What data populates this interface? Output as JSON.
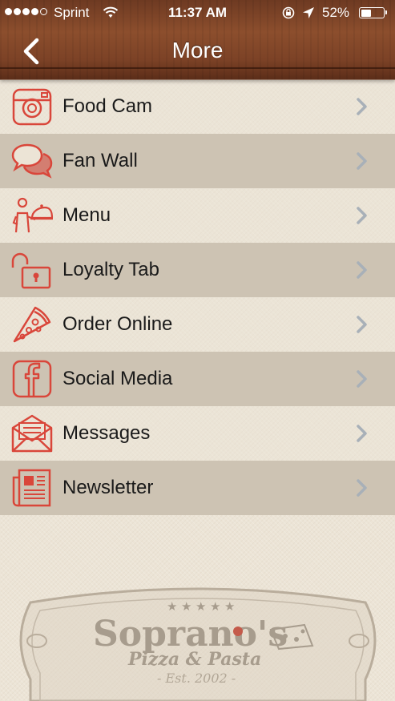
{
  "status_bar": {
    "carrier": "Sprint",
    "time": "11:37 AM",
    "battery_percent": "52%",
    "battery_level": 0.52,
    "signal_bars_filled": 4,
    "signal_bars_total": 5
  },
  "nav": {
    "title": "More",
    "back_icon": "chevron-left-icon"
  },
  "menu": {
    "items": [
      {
        "label": "Food Cam",
        "icon": "camera-icon"
      },
      {
        "label": "Fan Wall",
        "icon": "chat-bubbles-icon"
      },
      {
        "label": "Menu",
        "icon": "waiter-icon"
      },
      {
        "label": "Loyalty Tab",
        "icon": "unlock-icon"
      },
      {
        "label": "Order Online",
        "icon": "pizza-slice-icon"
      },
      {
        "label": "Social Media",
        "icon": "facebook-icon"
      },
      {
        "label": "Messages",
        "icon": "envelope-icon"
      },
      {
        "label": "Newsletter",
        "icon": "newspaper-icon"
      }
    ]
  },
  "logo": {
    "name": "Soprano's",
    "tagline": "Pizza & Pasta",
    "est": "- Est. 2002 -"
  },
  "colors": {
    "icon_red": "#d9463a",
    "row_alt": "#cdc3b3",
    "background": "#ece4d6",
    "chevron": "#a8b0b8",
    "header_wood": "#7c4226"
  }
}
